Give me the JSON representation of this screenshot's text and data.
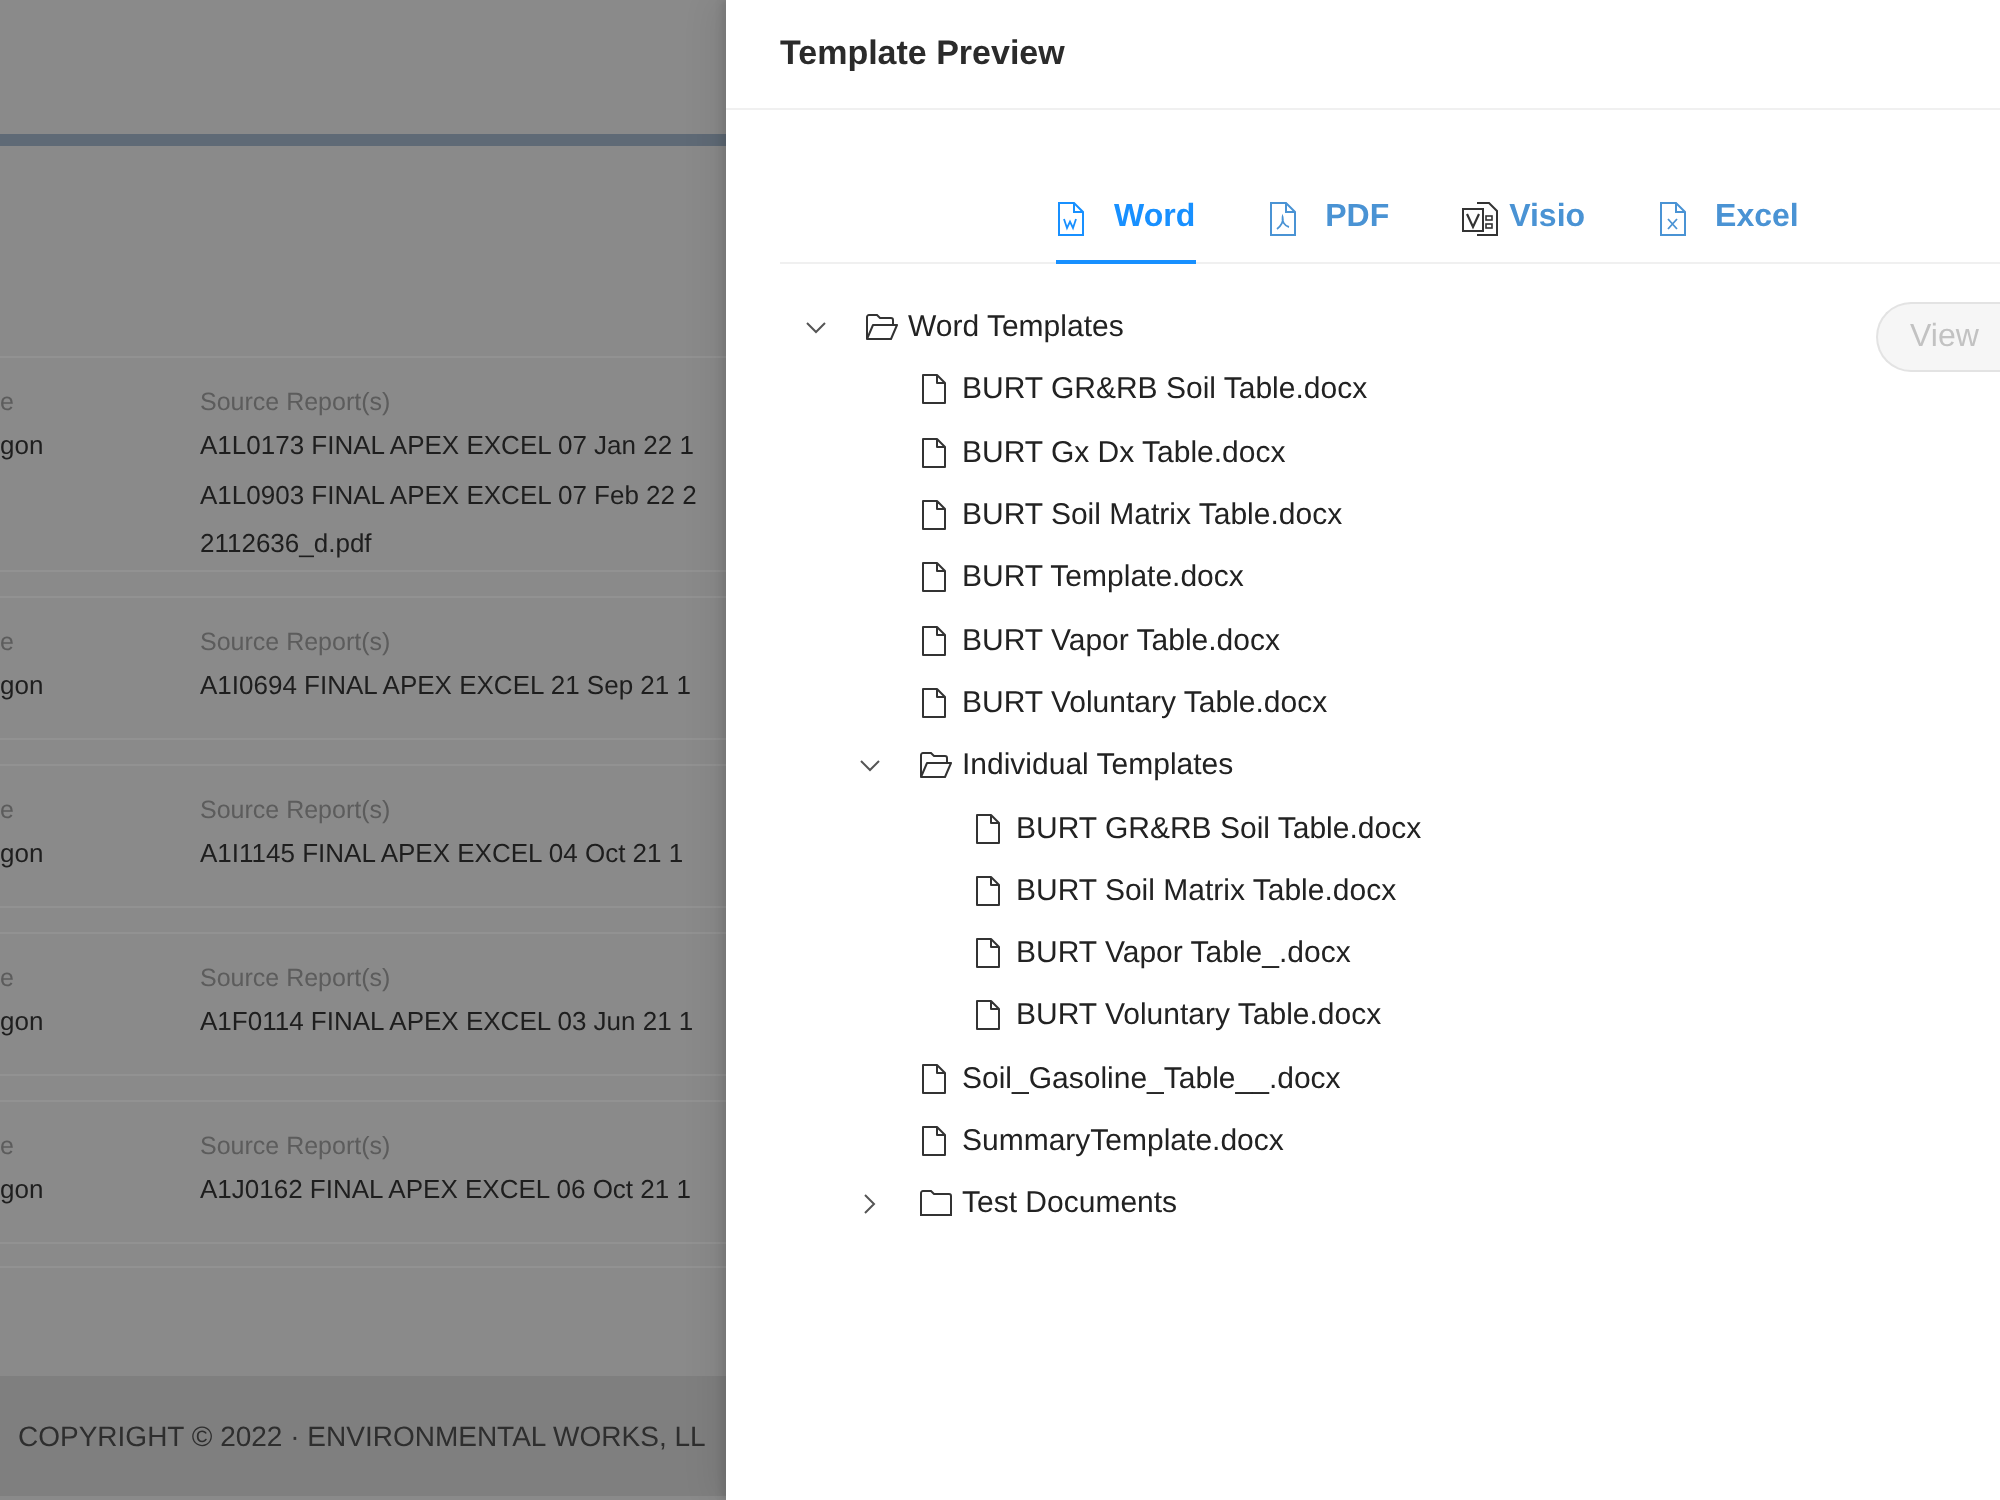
{
  "background_page": {
    "rows": [
      {
        "label": "e",
        "value": "gon",
        "source_label": "Source Report(s)",
        "sources": [
          "A1L0173 FINAL APEX EXCEL 07 Jan 22 1",
          "A1L0903 FINAL APEX EXCEL 07 Feb 22 2",
          "2112636_d.pdf"
        ]
      },
      {
        "label": "e",
        "value": "gon",
        "source_label": "Source Report(s)",
        "sources": [
          "A1I0694 FINAL APEX EXCEL 21 Sep 21 1"
        ]
      },
      {
        "label": "e",
        "value": "gon",
        "source_label": "Source Report(s)",
        "sources": [
          "A1I1145 FINAL APEX EXCEL 04 Oct 21 1"
        ]
      },
      {
        "label": "e",
        "value": "gon",
        "source_label": "Source Report(s)",
        "sources": [
          "A1F0114 FINAL APEX EXCEL 03 Jun 21 1"
        ]
      },
      {
        "label": "e",
        "value": "gon",
        "source_label": "Source Report(s)",
        "sources": [
          "A1J0162 FINAL APEX EXCEL 06 Oct 21 1"
        ]
      }
    ],
    "footer": "COPYRIGHT © 2022 · ENVIRONMENTAL WORKS, LL"
  },
  "drawer": {
    "title": "Template Preview",
    "tabs": [
      {
        "label": "Word",
        "kind": "word",
        "selected": true
      },
      {
        "label": "PDF",
        "kind": "pdf",
        "selected": false
      },
      {
        "label": "Visio",
        "kind": "visio",
        "selected": false
      },
      {
        "label": "Excel",
        "kind": "excel",
        "selected": false
      }
    ],
    "tree": [
      {
        "kind": "folder",
        "label": "Word Templates",
        "expanded": true,
        "selected": false,
        "children": [
          {
            "kind": "file",
            "label": "BURT GR&RB Soil Table.docx",
            "selected": false
          },
          {
            "kind": "file",
            "label": "BURT Gx Dx Table.docx",
            "selected": false
          },
          {
            "kind": "file",
            "label": "BURT Soil Matrix Table.docx",
            "selected": false
          },
          {
            "kind": "file",
            "label": "BURT Template.docx",
            "selected": false
          },
          {
            "kind": "file",
            "label": "BURT Vapor Table.docx",
            "selected": false
          },
          {
            "kind": "file",
            "label": "BURT Voluntary Table.docx",
            "selected": false
          },
          {
            "kind": "folder",
            "label": "Individual Templates",
            "expanded": true,
            "selected": false,
            "children": [
              {
                "kind": "file",
                "label": "BURT GR&RB Soil Table.docx",
                "selected": false
              },
              {
                "kind": "file",
                "label": "BURT Soil Matrix Table.docx",
                "selected": false
              },
              {
                "kind": "file",
                "label": "BURT Vapor Table_.docx",
                "selected": false
              },
              {
                "kind": "file",
                "label": "BURT Voluntary Table.docx",
                "selected": false
              }
            ]
          },
          {
            "kind": "file",
            "label": "Soil_Gasoline_Table__.docx",
            "selected": false
          },
          {
            "kind": "file",
            "label": "SummaryTemplate.docx",
            "selected": false
          },
          {
            "kind": "folder",
            "label": "Test Documents",
            "expanded": false,
            "selected": false
          }
        ]
      }
    ],
    "view_button": {
      "label": "View",
      "disabled": true
    }
  }
}
